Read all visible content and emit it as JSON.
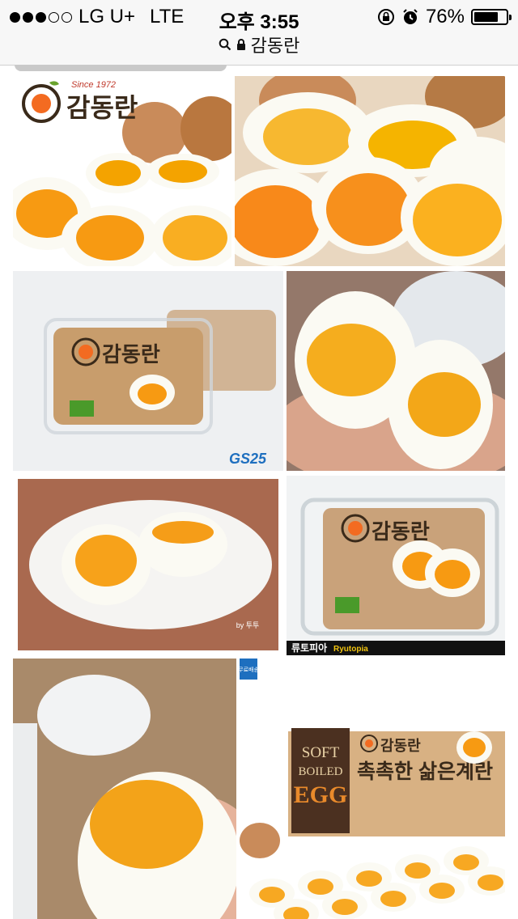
{
  "status_bar": {
    "carrier": "LG U+",
    "network": "LTE",
    "time": "오후 3:55",
    "battery_percent": "76%",
    "battery_level": 0.76,
    "signal_bars": 3
  },
  "url_bar": {
    "query": "감동란",
    "lock_icon": "lock-icon",
    "search_icon": "search-icon"
  },
  "images": {
    "tile1": {
      "brand": "감동란",
      "since": "Since 1972"
    },
    "tile3": {
      "brand": "감동란",
      "store": "GS25"
    },
    "tile5": {
      "watermark": "by 투투"
    },
    "tile6": {
      "brand": "감동란",
      "caption": "류토피아",
      "caption_en": "Ryutopia"
    },
    "tile8": {
      "badge": "무료배송",
      "box_line1": "SOFT",
      "box_line2": "BOILED",
      "box_line3": "EGG",
      "brand": "감동란",
      "tagline": "촉촉한 삶은계란"
    }
  },
  "colors": {
    "yolk": "#f79a12",
    "brand_red": "#c0392b",
    "brand_green": "#4a9a2a",
    "gs_blue": "#1e6fbf"
  }
}
